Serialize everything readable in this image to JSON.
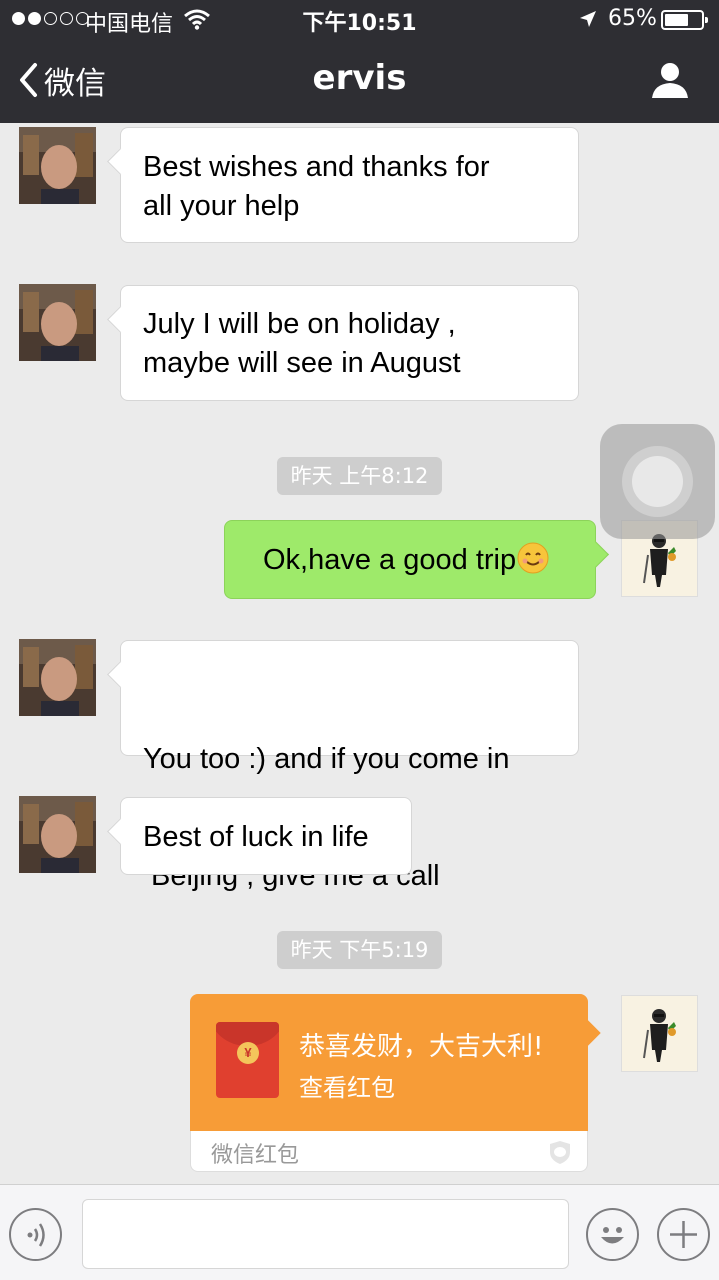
{
  "status_bar": {
    "carrier": "中国电信",
    "time": "下午10:51",
    "battery_percent": "65%",
    "battery_level": 0.65,
    "signal_bars_filled": 2,
    "signal_bars_total": 5
  },
  "nav": {
    "back_label": "微信",
    "title": "ervis",
    "icons": [
      "back-chevron-icon",
      "profile-icon"
    ]
  },
  "messages": [
    {
      "from": "friend",
      "lines": [
        "Best wishes and thanks for",
        "all your help"
      ]
    },
    {
      "from": "friend",
      "lines": [
        "July I will be on holiday ,",
        "maybe will see in August"
      ]
    },
    {
      "type": "timestamp",
      "text": "昨天 上午8:12"
    },
    {
      "from": "me",
      "text": "Ok,have a good trip",
      "emoji": "smiling-face-icon"
    },
    {
      "from": "friend",
      "lines": [
        "You too :) and if you come in",
        " Beijing , give me a call"
      ]
    },
    {
      "from": "friend",
      "lines": [
        "Best of luck in life"
      ]
    },
    {
      "type": "timestamp",
      "text": "昨天 下午5:19"
    },
    {
      "from": "me",
      "type": "red_packet",
      "title": "恭喜发财，大吉大利!",
      "action": "查看红包",
      "brand": "微信红包",
      "coin_symbol": "¥"
    }
  ],
  "input_bar": {
    "voice_icon": "voice-icon",
    "emoji_icon": "emoji-icon",
    "plus_icon": "plus-icon",
    "placeholder": ""
  },
  "colors": {
    "nav_bg": "#2e2e33",
    "chat_bg": "#ebebeb",
    "my_bubble": "#9eea6a",
    "red_packet": "#f79c37",
    "envelope": "#e0402f"
  }
}
